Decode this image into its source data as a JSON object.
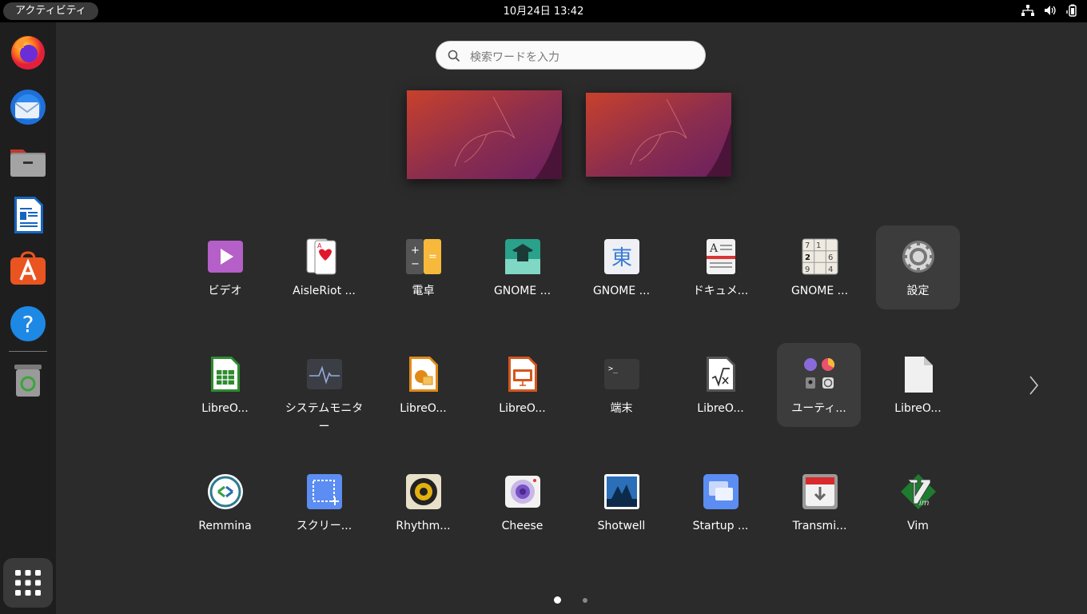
{
  "topbar": {
    "activities": "アクティビティ",
    "clock": "10月24日  13:42"
  },
  "search": {
    "placeholder": "検索ワードを入力"
  },
  "dock": [
    "firefox",
    "thunderbird",
    "files",
    "libreoffice-writer",
    "app-center",
    "help",
    "trash"
  ],
  "apps": [
    {
      "label": "ビデオ",
      "icon": "video-icon",
      "hl": false
    },
    {
      "label": "AisleRiot ...",
      "icon": "cards-icon",
      "hl": false
    },
    {
      "label": "電卓",
      "icon": "calculator-icon",
      "hl": false
    },
    {
      "label": "GNOME ...",
      "icon": "mahjongg-icon",
      "hl": false
    },
    {
      "label": "GNOME ...",
      "icon": "kanji-icon",
      "hl": false
    },
    {
      "label": "ドキュメ...",
      "icon": "document-viewer-icon",
      "hl": false
    },
    {
      "label": "GNOME ...",
      "icon": "sudoku-icon",
      "hl": false
    },
    {
      "label": "設定",
      "icon": "settings-gear-icon",
      "hl": true
    },
    {
      "label": "LibreO...",
      "icon": "calc-spreadsheet-icon",
      "hl": false
    },
    {
      "label": "システムモニター",
      "icon": "system-monitor-icon",
      "hl": false
    },
    {
      "label": "LibreO...",
      "icon": "draw-icon",
      "hl": false
    },
    {
      "label": "LibreO...",
      "icon": "impress-icon",
      "hl": false
    },
    {
      "label": "端末",
      "icon": "terminal-icon",
      "hl": false
    },
    {
      "label": "LibreO...",
      "icon": "math-icon",
      "hl": false
    },
    {
      "label": "ユーティ...",
      "icon": "utilities-folder-icon",
      "hl": true
    },
    {
      "label": "LibreO...",
      "icon": "libreoffice-icon",
      "hl": false
    },
    {
      "label": "Remmina",
      "icon": "remmina-icon",
      "hl": false
    },
    {
      "label": "スクリー...",
      "icon": "screenshot-icon",
      "hl": false
    },
    {
      "label": "Rhythm...",
      "icon": "rhythmbox-icon",
      "hl": false
    },
    {
      "label": "Cheese",
      "icon": "cheese-icon",
      "hl": false
    },
    {
      "label": "Shotwell",
      "icon": "shotwell-icon",
      "hl": false
    },
    {
      "label": "Startup ...",
      "icon": "startup-disk-icon",
      "hl": false
    },
    {
      "label": "Transmi...",
      "icon": "transmission-icon",
      "hl": false
    },
    {
      "label": "Vim",
      "icon": "vim-icon",
      "hl": false
    }
  ],
  "pager": {
    "pages": 2,
    "current": 1
  },
  "colors": {
    "accent": "#e95420",
    "panel": "#000000",
    "dock": "#1e1e1e",
    "background": "#2b2b2b"
  }
}
